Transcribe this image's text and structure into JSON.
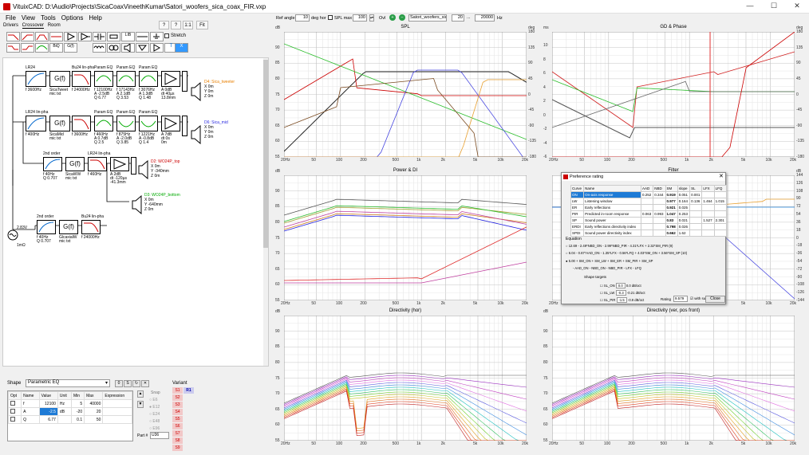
{
  "window": {
    "title": "VituixCAD: D:\\Audio\\Projects\\SicaCoaxVineethKumar\\Satori_woofers_sica_coax_FIR.vxp",
    "min": "—",
    "max": "☐",
    "close": "✕"
  },
  "menu": [
    "File",
    "View",
    "Tools",
    "Options",
    "Help"
  ],
  "tabs": [
    "Drivers",
    "Crossover",
    "Room"
  ],
  "zoom": {
    "zoom_in": "?",
    "zoom_out": "?",
    "one": "1:1",
    "fit": "Fit"
  },
  "stretch_label": "Stretch",
  "top_controls": {
    "ref_angle_label": "Ref angle",
    "ref_angle_value": "10",
    "deg_hor": "deg hor",
    "spl_max_label": "SPL max",
    "spl_max_value": "100",
    "ovl": "Ovl",
    "file_value": "Satori_woofers_sica_co",
    "f_from": "20",
    "f_to": "20000",
    "hz": "Hz",
    "dots": "..."
  },
  "drivers": {
    "tweeter": [
      "D4: Sica_tweeter",
      "X 0m",
      "Y 0m",
      "Z 0m"
    ],
    "mid": [
      "D6: Sica_mid",
      "X 0m",
      "Y 0m",
      "Z 0m"
    ],
    "w24top": [
      "D2: WO24P_top",
      "X 0m",
      "Y -340mm",
      "Z 0m"
    ],
    "w24bottom": [
      "D3: WO24P_bottom",
      "X 0m",
      "Y -640mm",
      "Z 0m"
    ]
  },
  "blocks": {
    "row1": [
      "LR24",
      "G(f)",
      "Bu24 lin-pha",
      "Param EQ",
      "Param EQ",
      "Param EQ"
    ],
    "row1_params": [
      "f 3600Hz",
      "SicaTweet\nmic txt",
      "f 24000Hz",
      "f 12100Hz\nA -2.5dB\nQ 6.77",
      "f 17143Hz\nA 2.1dB\nQ 3.53",
      "f 3076Hz\nA 1.3dB\nQ 1.48",
      "A 0dB\ndt 40µs\n13.8mm"
    ],
    "row2": [
      "LR24 lin-pha",
      "G(f)",
      "Param EQ",
      "Param EQ",
      "Param EQ"
    ],
    "row2_params": [
      "f 400Hz",
      "SicaMid\nmic txt",
      "f 3600Hz",
      "f 460Hz\nA 0.7dB\nQ 2.5",
      "f 875Hz\nA -2.0dB\nQ 3.85",
      "f 1221Hz\nA -0.8dB\nQ 1.4",
      "A 7dB\ndt 0s\n0m"
    ],
    "row3": [
      "2nd order",
      "G(f)",
      "LR24 lin-pha"
    ],
    "row3_params": [
      "f 40Hz\nQ 0.707",
      "SicaWW\nmic txt",
      "f 460Hz",
      "A 2dB\ndt -120µs\n-41.3mm"
    ],
    "row4": [
      "2nd order",
      "G(f)",
      "Bu24 lin-pha"
    ],
    "row4_params": [
      "f 40Hz\nQ 0.707",
      "GlcaxialW\nmic txt",
      "f 24000Hz"
    ],
    "source": [
      "2.83V",
      "1mΩ"
    ]
  },
  "shape": {
    "label": "Shape",
    "value": "Parametric EQ",
    "buttons": [
      "0",
      "S",
      "↻",
      "✕"
    ]
  },
  "opt_table": {
    "headers": [
      "Opt",
      "Name",
      "Value",
      "Unit",
      "Min",
      "Max",
      "Expression"
    ],
    "rows": [
      [
        "",
        "f",
        "12100",
        "Hz",
        "5",
        "40000",
        ""
      ],
      [
        "",
        "A",
        "-2.5",
        "dB",
        "-20",
        "20",
        ""
      ],
      [
        "",
        "Q",
        "6.77",
        "",
        "0.1",
        "50",
        ""
      ]
    ]
  },
  "snap": {
    "label": "Snap",
    "items": [
      "E6",
      "E12",
      "E24",
      "E48",
      "E96"
    ]
  },
  "part_label": "Part #",
  "part_value": "U36",
  "variant": {
    "label": "Variant",
    "items": [
      "S1",
      "S2",
      "S3",
      "S4",
      "S5",
      "S6",
      "S7",
      "S8",
      "S9"
    ],
    "r1": "R1"
  },
  "plots": {
    "spl": {
      "title": "SPL",
      "yl": [
        "dB",
        "90",
        "85",
        "80",
        "75",
        "70",
        "65",
        "60",
        "55"
      ],
      "yr": [
        "deg",
        "180",
        "135",
        "90",
        "45",
        "0",
        "-45",
        "-90",
        "-135",
        "-180"
      ]
    },
    "gd": {
      "title": "GD & Phase",
      "yl": [
        "ms",
        "10",
        "8",
        "6",
        "4",
        "2",
        "0",
        "-2",
        "-4",
        "-6"
      ],
      "yr": [
        "deg",
        "180",
        "135",
        "90",
        "45",
        "0",
        "-45",
        "-90",
        "-135",
        "-180"
      ]
    },
    "pdi": {
      "title": "Power & DI",
      "yl": [
        "dB",
        "90",
        "85",
        "80",
        "75",
        "70",
        "65",
        "60",
        "55"
      ]
    },
    "filter": {
      "title": "Filter",
      "yr": [
        "dB",
        "144",
        "126",
        "108",
        "90",
        "72",
        "54",
        "36",
        "18",
        "0",
        "-18",
        "-36",
        "-54",
        "-72",
        "-90",
        "-108",
        "-126",
        "-144"
      ]
    },
    "dirh": {
      "title": "Directivity (hor)",
      "yl": [
        "dB",
        "90",
        "85",
        "80",
        "75",
        "70",
        "65",
        "60",
        "55"
      ]
    },
    "dirv": {
      "title": "Directivity (ver, pos front)",
      "yl": [
        "dB",
        "90",
        "85",
        "80",
        "75",
        "70",
        "65",
        "60",
        "55"
      ]
    },
    "x": [
      "20Hz",
      "50",
      "100",
      "200",
      "500",
      "1k",
      "2k",
      "5k",
      "10k",
      "20k"
    ]
  },
  "pref": {
    "title": "Preference rating",
    "headers": [
      "Curve",
      "Name",
      "AAD",
      "NBD",
      "SM",
      "slope",
      "SL",
      "LFX",
      "LFQ"
    ],
    "rows": [
      [
        "ON",
        "On-axis response",
        "0.252",
        "0.344",
        "0.919",
        "0.051",
        "0.001",
        "",
        ""
      ],
      [
        "LW",
        "Listening window",
        "",
        "",
        "0.977",
        "0.164",
        "0.136",
        "1.464",
        "1.015"
      ],
      [
        "ER",
        "Early reflections",
        "",
        "",
        "0.921",
        "0.025",
        "",
        "",
        ""
      ],
      [
        "PIR",
        "Predicted in-room response",
        "0.063",
        "0.993",
        "1.047",
        "0.253",
        "",
        "",
        ""
      ],
      [
        "SP",
        "Sound power",
        "",
        "",
        "0.83",
        "0.021",
        "",
        "1.527",
        "2.301"
      ],
      [
        "ERDI",
        "Early reflections directivity index",
        "",
        "",
        "0.798",
        "0.026",
        "",
        "",
        ""
      ],
      [
        "SPDI",
        "Sound power directivity index",
        "",
        "",
        "0.662",
        "1.62",
        "",
        "",
        ""
      ]
    ],
    "equation_label": "Equation",
    "eq1": "12.69 - 2.49*NBD_ON - 2.99*NBD_PIR - 4.31*LFX + 2.32*SM_PIR (9)",
    "eq2": "6.04 - 0.67*AAD_ON - 1.35*LFX - 0.56*LFQ + 4.03*SM_ON + 3.56*SM_SP (10)",
    "eq3": "5.00 + SM_ON   + SM_LW   + SM_ER   + SM_PIR   + SM_SP",
    "eq3_vals": [
      "1.00",
      "1.00",
      "1.00",
      "1.00",
      "1.00"
    ],
    "eq3b": "- AAD_ON   - NBD_ON   - NBD_PIR   - LFX   - LFQ",
    "eq3b_vals": [
      "0.00",
      "1.00",
      "0.00",
      "0.00",
      "0.00"
    ],
    "shape_targets": "Shape targets",
    "targets": [
      [
        "SL_ON",
        "0.0",
        "0.0 dB/oct"
      ],
      [
        "SL_LW",
        "-0.3",
        "-0.21 dB/oct"
      ],
      [
        "SL_PIR",
        "-1.5",
        "-0.9 dB/oct"
      ]
    ],
    "rating_label": "Rating",
    "rating_value": "9.579",
    "with_sub": "with sub",
    "close": "Close"
  }
}
